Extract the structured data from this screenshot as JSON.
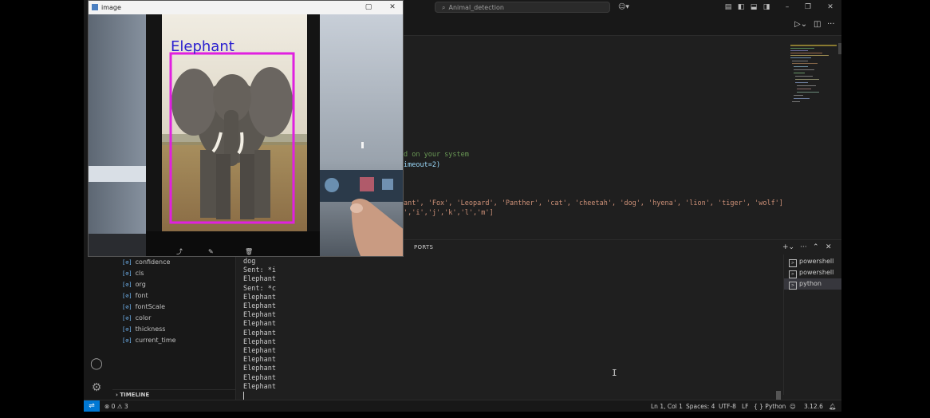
{
  "titlebar": {
    "search_text": "Animal_detection"
  },
  "explorer": {
    "variables": [
      "confidence",
      "cls",
      "org",
      "font",
      "fontScale",
      "color",
      "thickness",
      "current_time"
    ],
    "var_symbol": "[⊘]",
    "timeline_label": "TIMELINE"
  },
  "editor": {
    "lines": [
      "d on your system",
      "imeout=2)",
      "ant', 'Fox', 'Leopard', 'Panther', 'cat', 'cheetah', 'dog', 'hyena', 'lion', 'tiger', 'wolf']",
      "','i','j','k','l','m']"
    ]
  },
  "panel": {
    "ports_label": "PORTS",
    "terminals": [
      "powershell",
      "powershell",
      "python"
    ],
    "output": [
      "dog",
      "Sent: *i",
      "Elephant",
      "Sent: *c",
      "Elephant",
      "Elephant",
      "Elephant",
      "Elephant",
      "Elephant",
      "Elephant",
      "Elephant",
      "Elephant",
      "Elephant",
      "Elephant",
      "Elephant"
    ]
  },
  "statusbar": {
    "problems": "⊗ 0 ⚠ 3",
    "position": "Ln 1, Col 1",
    "spaces": "Spaces: 4",
    "encoding": "UTF-8",
    "eol": "LF",
    "language": "{ } Python",
    "version": "3.12.6"
  },
  "image_window": {
    "title": "image",
    "detection_label": "Elephant",
    "box_color": "#e020e0",
    "label_color": "#2a1fd0"
  },
  "colors": {
    "accent": "#0078d4",
    "background": "#1f1f1f"
  }
}
